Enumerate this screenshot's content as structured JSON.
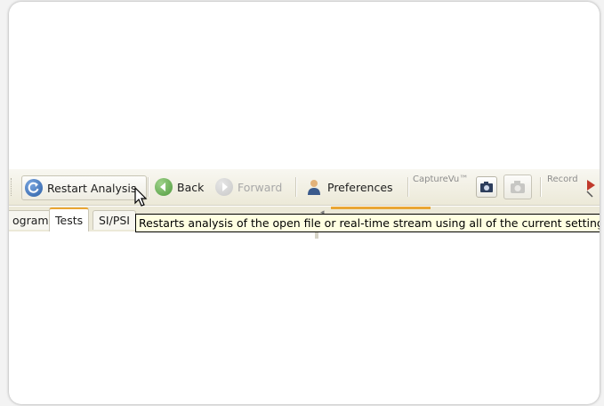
{
  "toolbar": {
    "restart_label": "Restart Analysis",
    "back_label": "Back",
    "forward_label": "Forward",
    "preferences_label": "Preferences",
    "capturevu_label": "CaptureVu™",
    "record_label": "Record"
  },
  "tabs": [
    {
      "label": "ogram"
    },
    {
      "label": "Tests",
      "active": true
    },
    {
      "label": "SI/PSI"
    }
  ],
  "tooltip": {
    "text": "Restarts analysis of the open file or real-time stream using all of the current settings"
  },
  "colors": {
    "restart_icon": "#2b5fa6",
    "back_icon": "#4f9a3d",
    "forward_icon_disabled": "#c8c8c8",
    "tooltip_bg": "#ffffe1",
    "active_tab_accent": "#e9a634"
  }
}
